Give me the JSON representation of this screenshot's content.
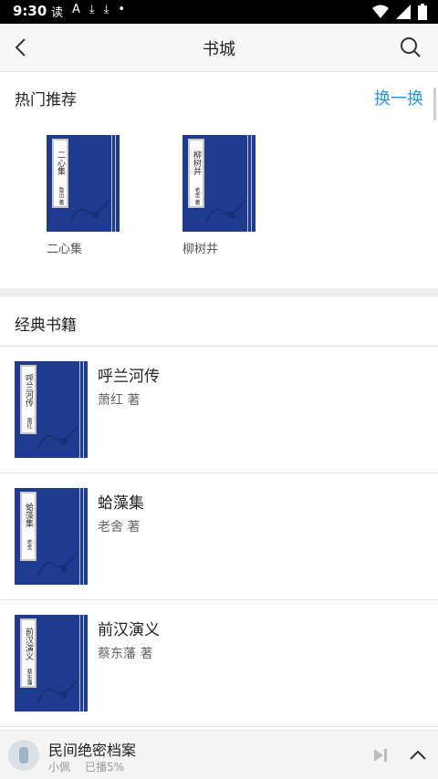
{
  "status_bar": {
    "time": "9:30",
    "notification_icons": [
      "读",
      "A",
      "⤓",
      "⤓",
      "•"
    ]
  },
  "header": {
    "title": "书城"
  },
  "hot_section": {
    "title": "热门推荐",
    "action": "换一换",
    "books": [
      {
        "name": "二心集",
        "cover_title": "二心集",
        "cover_author": "鲁迅 著"
      },
      {
        "name": "柳树井",
        "cover_title": "柳树井",
        "cover_author": "老舍 著"
      }
    ]
  },
  "classic_section": {
    "title": "经典书籍",
    "books": [
      {
        "title": "呼兰河传",
        "author": "萧红 著",
        "cover_title": "呼兰河传",
        "cover_author": "萧红"
      },
      {
        "title": "蛤藻集",
        "author": "老舍 著",
        "cover_title": "蛤藻集",
        "cover_author": "老舍"
      },
      {
        "title": "前汉演义",
        "author": "蔡东藩 著",
        "cover_title": "前汉演义",
        "cover_author": "蔡东藩"
      }
    ]
  },
  "player": {
    "title": "民间绝密档案",
    "narrator": "小佩",
    "progress_text": "已播5%"
  },
  "colors": {
    "accent": "#2196f3",
    "cover_blue": "#1f3b8f"
  }
}
